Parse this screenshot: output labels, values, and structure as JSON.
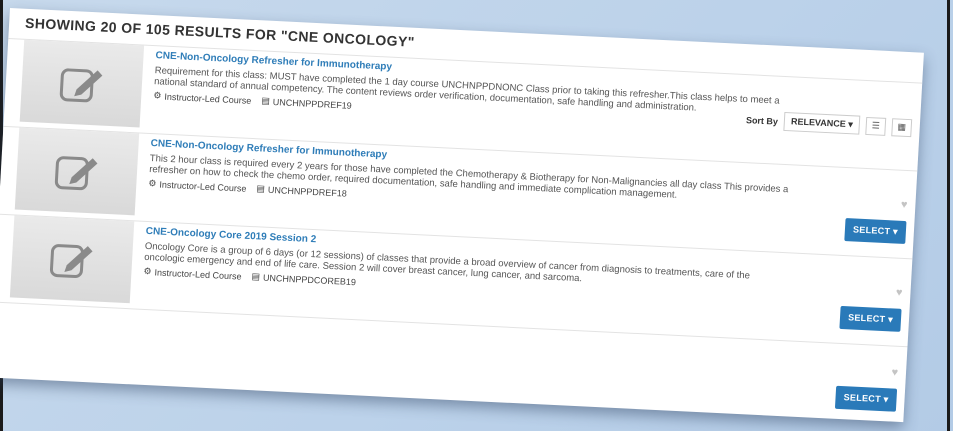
{
  "results_header": "SHOWING 20 OF 105 RESULTS FOR \"CNE ONCOLOGY\"",
  "sort": {
    "label": "Sort By",
    "value": "RELEVANCE",
    "caret": "▾"
  },
  "colors": {
    "link": "#2f7db8",
    "button": "#2a7ab9"
  },
  "courses": [
    {
      "title": "CNE-Non-Oncology Refresher for Immunotherapy",
      "description": "Requirement for this class: MUST have completed the 1 day course UNCHNPPDNONC Class prior to taking this refresher.This class helps to meet a national standard of annual competency. The content reviews order verification, documentation, safe handling and administration.",
      "type": "Instructor-Led Course",
      "code": "UNCHNPPDREF19",
      "select_label": "SELECT ▾"
    },
    {
      "title": "CNE-Non-Oncology Refresher for Immunotherapy",
      "description": "This 2 hour class is required every 2 years for those have completed the Chemotherapy & Biotherapy for Non-Malignancies all day class This provides a refresher on how to check the chemo order, required documentation, safe handling and immediate complication management.",
      "type": "Instructor-Led Course",
      "code": "UNCHNPPDREF18",
      "select_label": "SELECT ▾"
    },
    {
      "title": "CNE-Oncology Core 2019 Session 2",
      "description": "Oncology Core is a group of 6 days (or 12 sessions) of classes that provide a broad overview of cancer from diagnosis to treatments, care of the oncologic emergency and end of life care. Session 2 will cover breast cancer, lung cancer, and sarcoma.",
      "type": "Instructor-Led Course",
      "code": "UNCHNPPDCOREB19",
      "select_label": "SELECT ▾"
    }
  ]
}
